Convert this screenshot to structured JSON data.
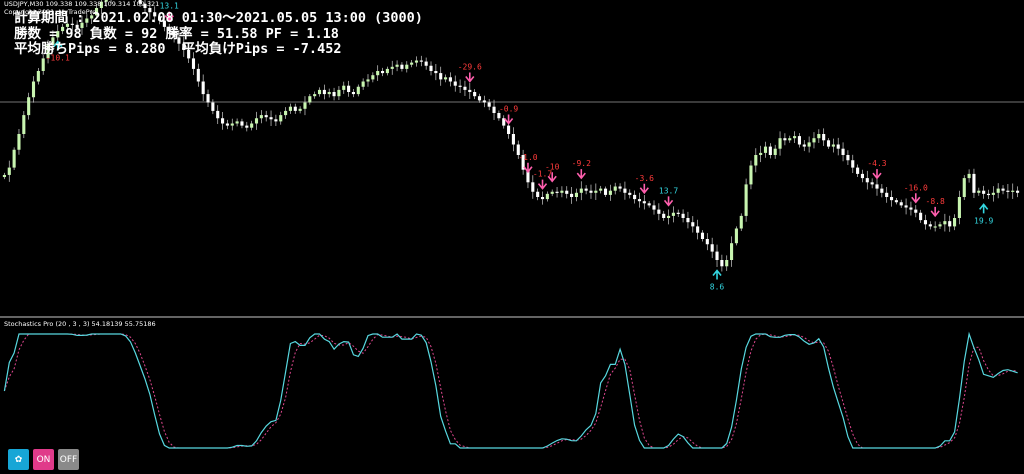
{
  "header": {
    "symbol_line": "USDJPY,M30  109.338 109.338 109.314 109.321",
    "copyright": "Copyright 2021, MyTradePro"
  },
  "stats": {
    "line1": "計算期間 : 2021.02.08 01:30～2021.05.05 13:00 (3000)",
    "line2": "勝数 = 98 負数 = 92 勝率 = 51.58 PF = 1.18",
    "line3": "平均勝ちPips = 8.280  平均負けPips = -7.452"
  },
  "stochastic_label": "Stochastics Pro (20 , 3 , 3) 54.18139 55.75186",
  "buttons": {
    "settings_icon": "gear-icon",
    "on": "ON",
    "off": "OFF"
  },
  "colors": {
    "bull": "#c8f5b0",
    "bear": "#ffffff",
    "signal_sell": "#ff5fae",
    "signal_buy": "#33d6e0",
    "profit_text": "#33d6e0",
    "loss_text": "#ff3b3b",
    "stoch_main": "#58d8e0",
    "stoch_signal": "#e04890"
  },
  "chart_data": {
    "type": "candlestick",
    "closes": [
      121,
      128,
      145,
      160,
      178,
      195,
      210,
      220,
      232,
      245,
      252,
      258,
      262,
      265,
      264,
      261,
      266,
      270,
      273,
      280,
      286,
      290,
      292,
      296,
      299,
      297,
      293,
      288,
      284,
      280,
      276,
      272,
      268,
      262,
      258,
      252,
      246,
      240,
      232,
      222,
      210,
      198,
      190,
      182,
      175,
      170,
      168,
      170,
      172,
      168,
      166,
      170,
      175,
      178,
      176,
      174,
      172,
      178,
      182,
      186,
      182,
      184,
      190,
      196,
      198,
      202,
      198,
      200,
      196,
      202,
      206,
      200,
      198,
      205,
      210,
      212,
      216,
      220,
      218,
      222,
      224,
      226,
      222,
      226,
      228,
      230,
      229,
      225,
      220,
      218,
      212,
      214,
      210,
      206,
      205,
      202,
      200,
      196,
      192,
      190,
      186,
      180,
      175,
      168,
      160,
      150,
      140,
      126,
      114,
      105,
      100,
      98,
      103,
      105,
      104,
      106,
      103,
      100,
      104,
      108,
      106,
      104,
      106,
      108,
      102,
      106,
      110,
      108,
      104,
      102,
      98,
      96,
      94,
      92,
      88,
      84,
      80,
      82,
      85,
      84,
      80,
      76,
      72,
      66,
      60,
      55,
      48,
      40,
      34,
      40,
      56,
      70,
      82,
      112,
      130,
      140,
      142,
      148,
      140,
      146,
      156,
      154,
      156,
      158,
      150,
      148,
      152,
      156,
      160,
      154,
      148,
      150,
      146,
      140,
      135,
      128,
      122,
      118,
      114,
      112,
      108,
      104,
      100,
      97,
      95,
      92,
      90,
      88,
      85,
      78,
      74,
      72,
      72,
      74,
      77,
      72,
      80,
      100,
      118,
      122,
      104,
      106,
      103,
      102,
      104,
      108,
      106,
      105,
      106,
      104
    ],
    "trades": [
      {
        "dir": "buy",
        "label": "-10.1"
      },
      {
        "dir": "sell",
        "label": "13.1"
      },
      {
        "dir": "sell",
        "label": "-29.6"
      },
      {
        "dir": "sell",
        "label": "-0.9"
      },
      {
        "dir": "sell",
        "label": "-1.0"
      },
      {
        "dir": "sell",
        "label": "-1.7"
      },
      {
        "dir": "sell",
        "label": "-10"
      },
      {
        "dir": "sell",
        "label": "-9.2"
      },
      {
        "dir": "sell",
        "label": "-3.6"
      },
      {
        "dir": "sell",
        "label": "13.7"
      },
      {
        "dir": "buy",
        "label": "8.6"
      },
      {
        "dir": "sell",
        "label": "-4.3"
      },
      {
        "dir": "sell",
        "label": "-16.0"
      },
      {
        "dir": "sell",
        "label": "-8.8"
      },
      {
        "dir": "buy",
        "label": "19.9"
      }
    ]
  }
}
